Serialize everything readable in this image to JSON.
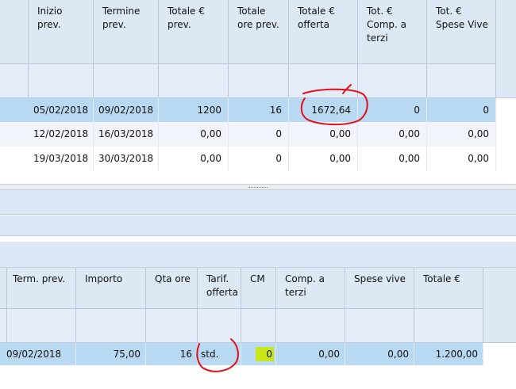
{
  "top_grid": {
    "columns": [
      {
        "key": "inizio",
        "label": "Inizio prev."
      },
      {
        "key": "termine",
        "label": "Termine prev."
      },
      {
        "key": "totale_prev",
        "label": "Totale € prev."
      },
      {
        "key": "ore_prev",
        "label": "Totale ore prev."
      },
      {
        "key": "offerta",
        "label": "Totale € offerta"
      },
      {
        "key": "comp_terzi",
        "label": "Tot. € Comp. a terzi"
      },
      {
        "key": "spese_vive",
        "label": "Tot. € Spese Vive"
      }
    ],
    "rows": [
      {
        "inizio": "05/02/2018",
        "termine": "09/02/2018",
        "totale_prev": "1200",
        "ore_prev": "16",
        "offerta": "1672,64",
        "comp_terzi": "0",
        "spese_vive": "0"
      },
      {
        "inizio": "12/02/2018",
        "termine": "16/03/2018",
        "totale_prev": "0,00",
        "ore_prev": "0",
        "offerta": "0,00",
        "comp_terzi": "0,00",
        "spese_vive": "0,00"
      },
      {
        "inizio": "19/03/2018",
        "termine": "30/03/2018",
        "totale_prev": "0,00",
        "ore_prev": "0",
        "offerta": "0,00",
        "comp_terzi": "0,00",
        "spese_vive": "0,00"
      }
    ]
  },
  "bottom_grid": {
    "columns": [
      {
        "key": "term",
        "label": "Term. prev."
      },
      {
        "key": "importo",
        "label": "Importo"
      },
      {
        "key": "qta",
        "label": "Qta ore"
      },
      {
        "key": "tarif",
        "label": "Tarif. offerta"
      },
      {
        "key": "cm",
        "label": "CM"
      },
      {
        "key": "comp",
        "label": "Comp. a terzi"
      },
      {
        "key": "spese",
        "label": "Spese vive"
      },
      {
        "key": "totale",
        "label": "Totale €"
      }
    ],
    "rows": [
      {
        "term": "09/02/2018",
        "importo": "75,00",
        "qta": "16",
        "tarif": "std.",
        "cm": "0",
        "comp": "0,00",
        "spese": "0,00",
        "totale": "1.200,00"
      }
    ]
  },
  "colors": {
    "selected_row": "#b9d8f2",
    "header_bg": "#dde8f5",
    "annotation": "#e0101a",
    "highlight": "#c8e61a"
  }
}
